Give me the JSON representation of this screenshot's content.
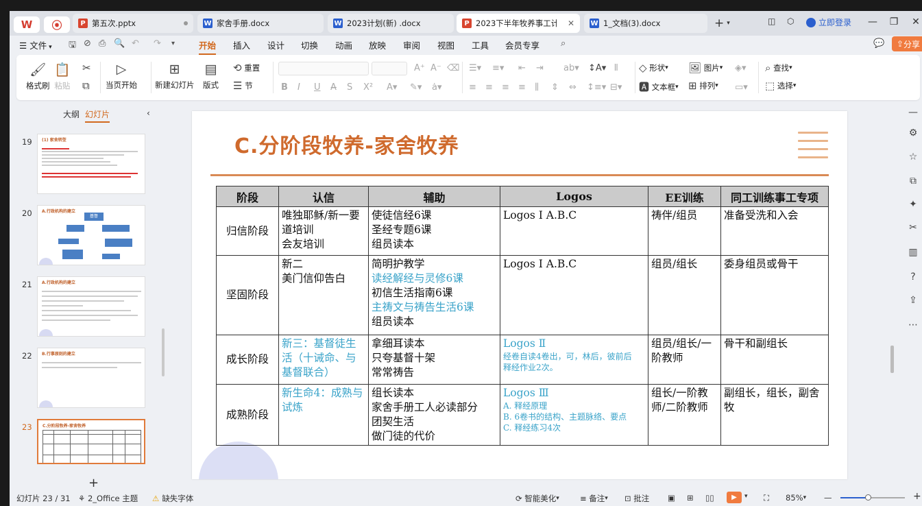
{
  "tabs": [
    {
      "label": "第五次.pptx",
      "type": "P"
    },
    {
      "label": "家舍手册.docx",
      "type": "W"
    },
    {
      "label": "2023计划(新) .docx",
      "type": "W"
    },
    {
      "label": "2023下半年牧养事工计划",
      "type": "P"
    },
    {
      "label": "1_文档(3).docx",
      "type": "W"
    }
  ],
  "titlebar": {
    "login": "立即登录",
    "new_tab": "+"
  },
  "menu": {
    "file": "文件",
    "items": [
      "开始",
      "插入",
      "设计",
      "切换",
      "动画",
      "放映",
      "审阅",
      "视图",
      "工具",
      "会员专享"
    ],
    "share": "分享"
  },
  "ribbon": {
    "format_painter": "格式刷",
    "paste": "粘贴",
    "play_from_current": "当页开始",
    "new_slide": "新建幻灯片",
    "layout": "版式",
    "reset": "重置",
    "section": "节",
    "shape": "形状",
    "picture": "图片",
    "find": "查找",
    "textbox": "文本框",
    "arrange": "排列",
    "select": "选择"
  },
  "left_panel": {
    "outline_tab": "大纲",
    "slides_tab": "幻灯片",
    "thumbs": [
      {
        "num": "19",
        "title": "(1) 家舍转型"
      },
      {
        "num": "20",
        "title": "A.行政机构的建立",
        "box": "基督"
      },
      {
        "num": "21",
        "title": "A.行政机构的建立"
      },
      {
        "num": "22",
        "title": "B.行事原则的建立"
      },
      {
        "num": "23",
        "title": "C.分阶段牧养-家舍牧养"
      }
    ]
  },
  "slide": {
    "title": "C.分阶段牧养-家舍牧养",
    "headers": [
      "阶段",
      "认信",
      "辅助",
      "Logos",
      "EE训练",
      "同工训练事工专项"
    ],
    "rows": [
      {
        "stage": "归信阶段",
        "faith": [
          {
            "t": "唯独耶稣/新一要道培训"
          },
          {
            "t": "会友培训"
          }
        ],
        "aid": [
          {
            "t": "使徒信经6课"
          },
          {
            "t": "圣经专题6课"
          },
          {
            "t": "组员读本"
          }
        ],
        "logos": [
          {
            "t": "Logos Ⅰ A.B.C"
          }
        ],
        "ee": "祷伴/组员",
        "coworker": "准备受洗和入会"
      },
      {
        "stage": "坚固阶段",
        "faith": [
          {
            "t": "新二"
          },
          {
            "t": "美门信仰告白"
          }
        ],
        "aid": [
          {
            "t": "简明护教学"
          },
          {
            "t": "读经解经与灵修6课",
            "c": "blue"
          },
          {
            "t": "初信生活指南6课"
          },
          {
            "t": "主祷文与祷告生活6课",
            "c": "blue"
          },
          {
            "t": "组员读本"
          }
        ],
        "logos": [
          {
            "t": "Logos Ⅰ A.B.C"
          }
        ],
        "ee": "组员/组长",
        "coworker": "委身组员或骨干"
      },
      {
        "stage": "成长阶段",
        "faith": [
          {
            "t": "新三：基督徒生活（十诫命、与基督联合）",
            "c": "blue"
          }
        ],
        "aid": [
          {
            "t": "拿细耳读本"
          },
          {
            "t": "只夸基督十架"
          },
          {
            "t": "常常祷告"
          }
        ],
        "logos": [
          {
            "t": "Logos Ⅱ",
            "c": "blue"
          },
          {
            "t": "经卷自读4卷出，可，林后，彼前后",
            "c": "blue",
            "s": true
          },
          {
            "t": "释经作业2次。",
            "c": "blue",
            "s": true
          }
        ],
        "ee": "组员/组长/一阶教师",
        "coworker": "骨干和副组长"
      },
      {
        "stage": "成熟阶段",
        "faith": [
          {
            "t": "新生命4：成熟与试炼",
            "c": "blue"
          }
        ],
        "aid": [
          {
            "t": "组长读本"
          },
          {
            "t": "家舍手册工人必读部分"
          },
          {
            "t": "团契生活"
          },
          {
            "t": "做门徒的代价"
          }
        ],
        "logos": [
          {
            "t": "Logos Ⅲ",
            "c": "blue"
          },
          {
            "t": "A. 释经原理",
            "c": "blue",
            "s": true
          },
          {
            "t": "B. 6卷书的结构、主题脉络、要点",
            "c": "blue",
            "s": true
          },
          {
            "t": "C. 释经练习4次",
            "c": "blue",
            "s": true
          }
        ],
        "ee": "组长/一阶教师/二阶教师",
        "coworker": "副组长，组长，副舍牧"
      }
    ]
  },
  "status": {
    "slide_counter": "幻灯片 23 / 31",
    "theme": "2_Office 主题",
    "missing_font": "缺失字体",
    "smart_beautify": "智能美化",
    "notes": "备注",
    "comments": "批注",
    "zoom": "85%",
    "zoom_value": 0.43
  },
  "colors": {
    "accent": "#cf6a2d",
    "blue_text": "#3aa3c9",
    "share": "#f07b3f"
  }
}
